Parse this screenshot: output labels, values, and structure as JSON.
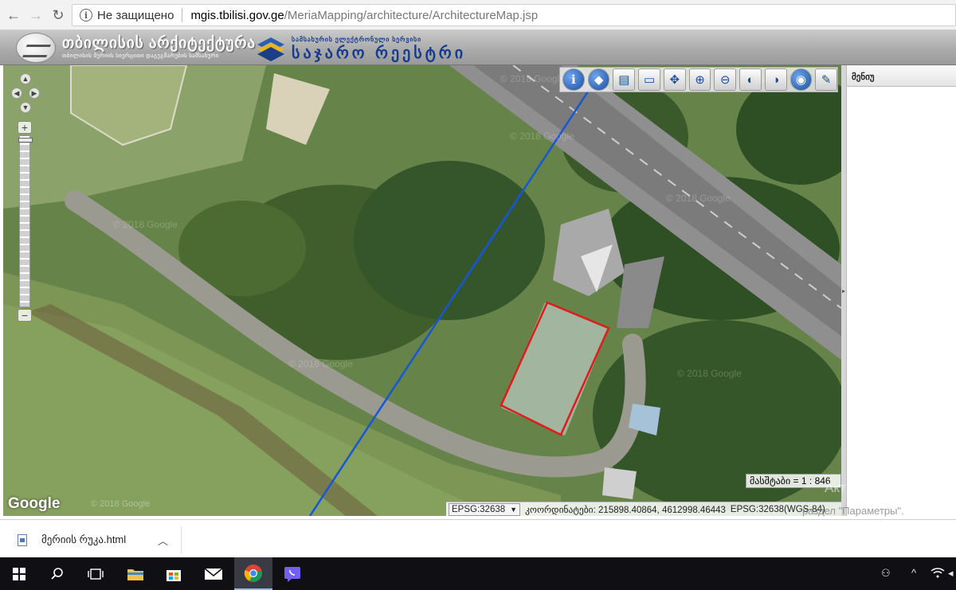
{
  "browser": {
    "back_icon": "back-arrow-icon",
    "forward_icon": "forward-arrow-icon",
    "reload_icon": "reload-icon",
    "security_label": "Не защищено",
    "url_host": "mgis.tbilisi.gov.ge",
    "url_path": "/MeriaMapping/architecture/ArchitectureMap.jsp"
  },
  "header": {
    "brand_title": "თბილისის არქიტექტურა",
    "brand_subtitle": "თბილისის მერიის სივრცითი დაგეგმარების სამსახური",
    "registry_subtitle": "სამსახურის ელექტრონული სერვისი",
    "registry_title": "საჯარო რეესტრი"
  },
  "map": {
    "zoom_in": "+",
    "zoom_out": "−",
    "pan_up": "▲",
    "pan_down": "▼",
    "pan_left": "◀",
    "pan_right": "▶",
    "toolbar": [
      {
        "name": "info-tool",
        "glyph": "i"
      },
      {
        "name": "identify-tool",
        "glyph": "◆"
      },
      {
        "name": "measure-area-tool",
        "glyph": "▤"
      },
      {
        "name": "measure-length-tool",
        "glyph": "▭"
      },
      {
        "name": "pan-tool",
        "glyph": "✥"
      },
      {
        "name": "zoom-in-tool",
        "glyph": "⊕"
      },
      {
        "name": "zoom-out-tool",
        "glyph": "⊖"
      },
      {
        "name": "zoom-previous-tool",
        "glyph": "◐"
      },
      {
        "name": "zoom-next-tool",
        "glyph": "◑"
      },
      {
        "name": "full-extent-tool",
        "glyph": "◉"
      },
      {
        "name": "clear-tool",
        "glyph": "✎"
      }
    ],
    "scale_label": "მასშტაბი = 1 : 846",
    "epsg_select": "EPSG:32638",
    "coords_label": "კოორდინატები: 215898.40864, 4612998.46443",
    "coords_crs": "EPSG:32638(WGS-84)",
    "google_logo": "Google",
    "copyright": "© 2018 Google",
    "watermark": "© 2018 Google"
  },
  "panel": {
    "menu_title": "მენიუ"
  },
  "os": {
    "activate_line1": "Акти",
    "activate_line2": "раздел \"Параметры\"."
  },
  "downloads": {
    "file_name": "მერიის რუკა.html"
  },
  "colors": {
    "parcel_outline": "#e01b1b",
    "line_feature": "#1657d6",
    "registry_blue": "#163b8a"
  }
}
